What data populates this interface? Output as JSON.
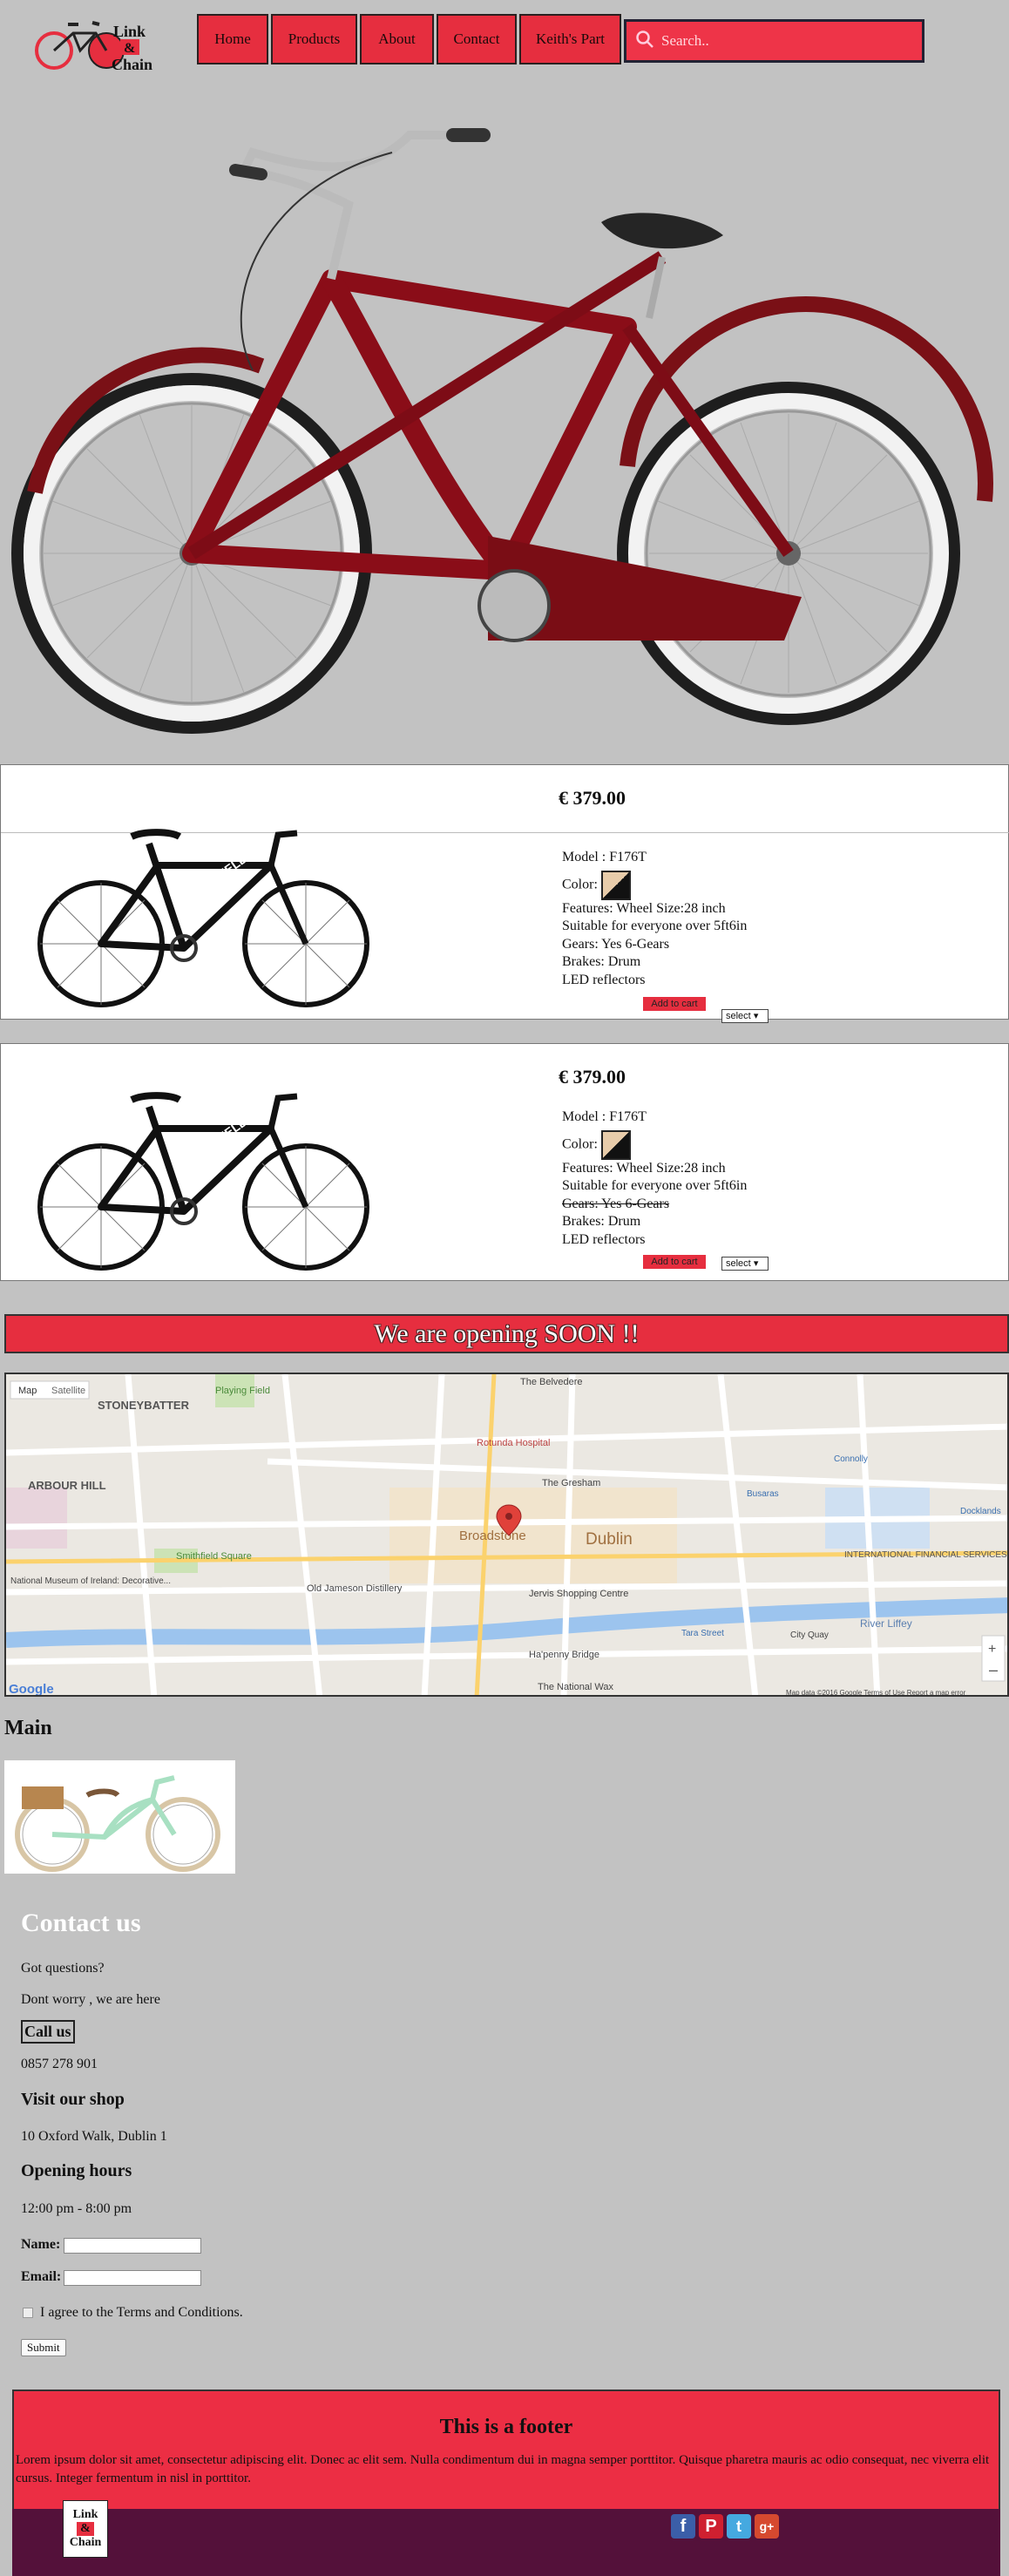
{
  "brand": {
    "line1": "Link",
    "line2": "&",
    "line3": "Chain"
  },
  "nav": {
    "items": [
      {
        "label": "Home"
      },
      {
        "label": "Products"
      },
      {
        "label": "About"
      },
      {
        "label": "Contact"
      },
      {
        "label": "Keith's Part"
      }
    ],
    "search_placeholder": "Search.."
  },
  "products": [
    {
      "price": "€ 379.00",
      "model": "Model : F176T",
      "color_label": "Color:",
      "features": "Features: Wheel Size:28 inch",
      "suitable": "Suitable for everyone over 5ft6in",
      "gears": "Gears: Yes 6-Gears",
      "brakes": "Brakes: Drum",
      "reflectors": "LED reflectors",
      "cart_label": "Add to cart",
      "select_value": "select"
    },
    {
      "price": "€ 379.00",
      "model": "Model : F176T",
      "color_label": "Color:",
      "features": "Features: Wheel Size:28 inch",
      "suitable": "Suitable for everyone over 5ft6in",
      "gears": "Gears: Yes 6-Gears",
      "brakes": "Brakes: Drum",
      "reflectors": "LED reflectors",
      "cart_label": "Add to cart",
      "select_value": "select"
    }
  ],
  "banner": {
    "text": "We are opening SOON !!"
  },
  "map": {
    "tab_map": "Map",
    "tab_satellite": "Satellite",
    "labels": {
      "stoneybatter": "STONEYBATTER",
      "arbour_hill": "ARBOUR HILL",
      "playing_field": "Playing Field",
      "rotunda": "Rotunda Hospital",
      "gresham": "The Gresham",
      "belvedere": "The Belvedere",
      "broadstone": "Broadstone",
      "dublin": "Dublin",
      "smithfield": "Smithfield Square",
      "jameson": "Old Jameson Distillery",
      "museum": "National Museum of Ireland: Decorative...",
      "jervis": "Jervis Shopping Centre",
      "hapenny": "Ha'penny Bridge",
      "wax": "The National Wax",
      "ifsc": "INTERNATIONAL FINANCIAL SERVICES CENTRE",
      "river": "River Liffey",
      "connolly": "Connolly",
      "busaras": "Busaras",
      "tara": "Tara Street",
      "city_quay": "City Quay",
      "docklands": "Docklands"
    },
    "google": "Google",
    "attribution": "Map data ©2016 Google   Terms of Use   Report a map error"
  },
  "main": {
    "heading": "Main"
  },
  "contact": {
    "title": "Contact us",
    "q1": "Got questions?",
    "q2": "Dont worry , we are here",
    "call_label": "Call us",
    "phone": "0857 278 901",
    "visit_heading": "Visit our shop",
    "address": "10 Oxford Walk, Dublin 1",
    "hours_heading": "Opening hours",
    "hours": "12:00 pm - 8:00 pm",
    "name_label": "Name:",
    "email_label": "Email:",
    "terms": "I agree to the Terms and Conditions.",
    "submit": "Submit"
  },
  "footer": {
    "title": "This is a footer",
    "text": "Lorem ipsum dolor sit amet, consectetur adipiscing elit. Donec ac elit sem. Nulla condimentum dui in magna semper porttitor. Quisque pharetra mauris ac odio consequat, nec viverra elit cursus. Integer fermentum in nisl in porttitor."
  },
  "social": [
    "facebook-icon",
    "pinterest-icon",
    "twitter-icon",
    "google-plus-icon"
  ],
  "colors": {
    "accent": "#e62e3f",
    "footer_bar": "#54113a",
    "page_bg": "#c2c2c2"
  }
}
